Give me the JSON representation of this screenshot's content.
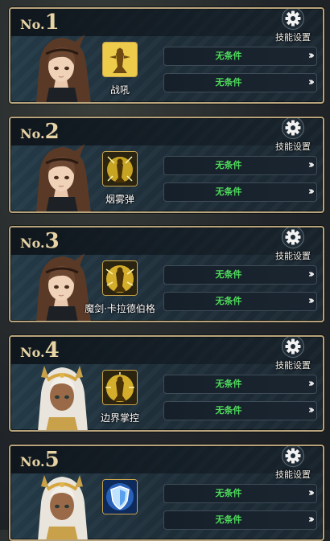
{
  "settings_label": "技能设置",
  "no_label": "No.",
  "slots": [
    {
      "number": "1",
      "skill_name": "战吼",
      "skill_icon": "warcry-icon",
      "portrait": "brown-hair-character",
      "conditions": [
        "无条件",
        "无条件"
      ]
    },
    {
      "number": "2",
      "skill_name": "烟雾弹",
      "skill_icon": "smoke-bomb-icon",
      "portrait": "brown-hair-character",
      "conditions": [
        "无条件",
        "无条件"
      ]
    },
    {
      "number": "3",
      "skill_name": "魔剑·卡拉德伯格",
      "skill_icon": "demon-sword-icon",
      "portrait": "brown-hair-character",
      "conditions": [
        "无条件",
        "无条件"
      ]
    },
    {
      "number": "4",
      "skill_name": "边界掌控",
      "skill_icon": "boundary-control-icon",
      "portrait": "white-hair-character",
      "conditions": [
        "无条件",
        "无条件"
      ]
    },
    {
      "number": "5",
      "skill_name": "",
      "skill_icon": "blue-shield-icon",
      "portrait": "white-hair-character",
      "conditions": [
        "无条件",
        "无条件"
      ]
    }
  ],
  "colors": {
    "accent_gold": "#e7d3a4",
    "condition_green": "#4fdc5b",
    "card_border": "#b8a47c"
  }
}
